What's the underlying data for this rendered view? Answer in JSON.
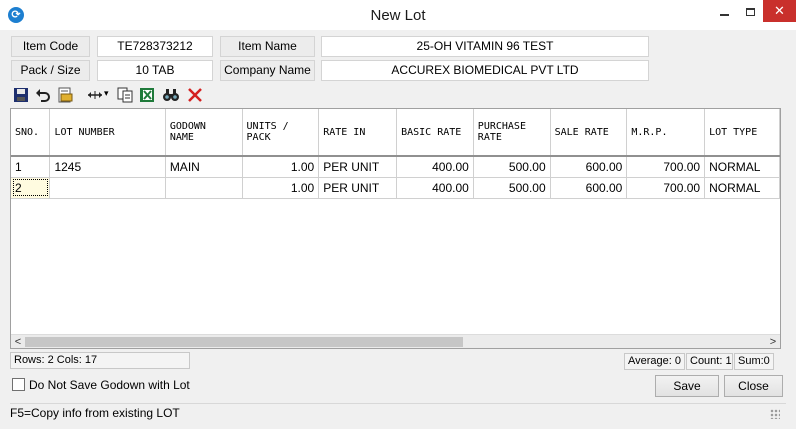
{
  "window": {
    "title": "New Lot",
    "close_glyph": "✕"
  },
  "header": {
    "item_code_label": "Item Code",
    "item_code_value": "TE728373212",
    "item_name_label": "Item Name",
    "item_name_value": "25-OH VITAMIN 96 TEST",
    "pack_size_label": "Pack / Size",
    "pack_size_value": "10 TAB",
    "company_name_label": "Company Name",
    "company_name_value": "ACCUREX BIOMEDICAL PVT LTD"
  },
  "toolbar": {
    "icons": [
      "save-icon",
      "undo-icon",
      "print-preview-icon",
      "column-width-icon",
      "copy-icon",
      "excel-export-icon",
      "find-icon",
      "delete-icon"
    ],
    "column_width_arrow": "▾"
  },
  "grid": {
    "columns": [
      {
        "line1": "SNO.",
        "line2": ""
      },
      {
        "line1": "LOT NUMBER",
        "line2": ""
      },
      {
        "line1": "GODOWN",
        "line2": "NAME"
      },
      {
        "line1": "UNITS /",
        "line2": "PACK"
      },
      {
        "line1": "RATE IN",
        "line2": ""
      },
      {
        "line1": "BASIC RATE",
        "line2": ""
      },
      {
        "line1": "PURCHASE",
        "line2": "RATE"
      },
      {
        "line1": "SALE RATE",
        "line2": ""
      },
      {
        "line1": "M.R.P.",
        "line2": ""
      },
      {
        "line1": "LOT TYPE",
        "line2": ""
      }
    ],
    "rows": [
      {
        "sno": "1",
        "lot_number": "1245",
        "godown": "MAIN",
        "units_pack": "1.00",
        "rate_in": "PER UNIT",
        "basic_rate": "400.00",
        "purchase_rate": "500.00",
        "sale_rate": "600.00",
        "mrp": "700.00",
        "lot_type": "NORMAL"
      },
      {
        "sno": "2",
        "lot_number": "",
        "godown": "",
        "units_pack": "1.00",
        "rate_in": "PER UNIT",
        "basic_rate": "400.00",
        "purchase_rate": "500.00",
        "sale_rate": "600.00",
        "mrp": "700.00",
        "lot_type": "NORMAL"
      }
    ],
    "scroll_left_glyph": "<",
    "scroll_right_glyph": ">"
  },
  "status": {
    "rows_cols": "Rows: 2  Cols: 17",
    "average": "Average: 0",
    "count": "Count: 1",
    "sum": "Sum:0"
  },
  "bottom": {
    "checkbox_label": "Do Not Save Godown with Lot",
    "save_label": "Save",
    "close_label": "Close",
    "hint": "F5=Copy info from existing LOT"
  }
}
